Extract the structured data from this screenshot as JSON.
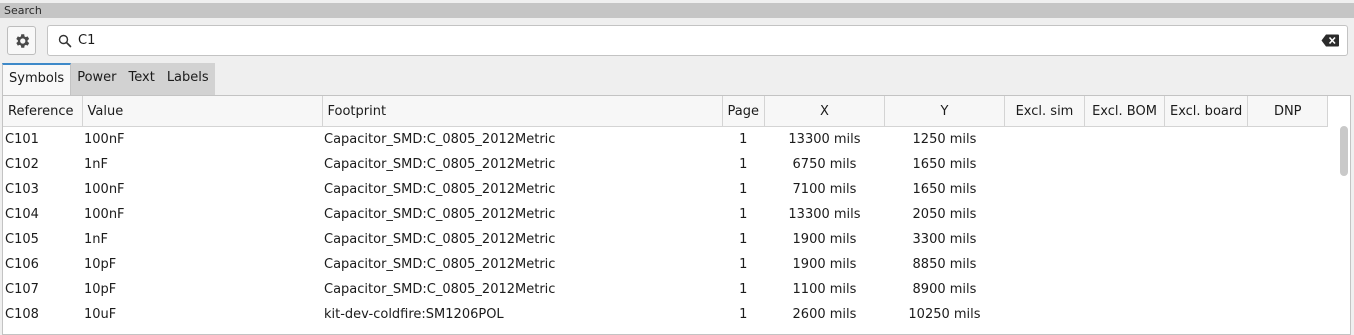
{
  "panel": {
    "title": "Search"
  },
  "search": {
    "value": "C1"
  },
  "icons": {
    "settings": "gear-icon",
    "search": "search-icon",
    "clear": "backspace-icon"
  },
  "colors": {
    "tab_accent": "#3d89c9"
  },
  "tabs": [
    {
      "label": "Symbols",
      "active": true
    },
    {
      "label": "Power",
      "active": false
    },
    {
      "label": "Text",
      "active": false
    },
    {
      "label": "Labels",
      "active": false
    }
  ],
  "table": {
    "columns": [
      "Reference",
      "Value",
      "Footprint",
      "Page",
      "X",
      "Y",
      "Excl. sim",
      "Excl. BOM",
      "Excl. board",
      "DNP"
    ],
    "rows": [
      {
        "reference": "C101",
        "value": "100nF",
        "footprint": "Capacitor_SMD:C_0805_2012Metric",
        "page": "1",
        "x": "13300 mils",
        "y": "1250 mils"
      },
      {
        "reference": "C102",
        "value": "1nF",
        "footprint": "Capacitor_SMD:C_0805_2012Metric",
        "page": "1",
        "x": "6750 mils",
        "y": "1650 mils"
      },
      {
        "reference": "C103",
        "value": "100nF",
        "footprint": "Capacitor_SMD:C_0805_2012Metric",
        "page": "1",
        "x": "7100 mils",
        "y": "1650 mils"
      },
      {
        "reference": "C104",
        "value": "100nF",
        "footprint": "Capacitor_SMD:C_0805_2012Metric",
        "page": "1",
        "x": "13300 mils",
        "y": "2050 mils"
      },
      {
        "reference": "C105",
        "value": "1nF",
        "footprint": "Capacitor_SMD:C_0805_2012Metric",
        "page": "1",
        "x": "1900 mils",
        "y": "3300 mils"
      },
      {
        "reference": "C106",
        "value": "10pF",
        "footprint": "Capacitor_SMD:C_0805_2012Metric",
        "page": "1",
        "x": "1900 mils",
        "y": "8850 mils"
      },
      {
        "reference": "C107",
        "value": "10pF",
        "footprint": "Capacitor_SMD:C_0805_2012Metric",
        "page": "1",
        "x": "1100 mils",
        "y": "8900 mils"
      },
      {
        "reference": "C108",
        "value": "10uF",
        "footprint": "kit-dev-coldfire:SM1206POL",
        "page": "1",
        "x": "2600 mils",
        "y": "10250 mils"
      }
    ]
  }
}
